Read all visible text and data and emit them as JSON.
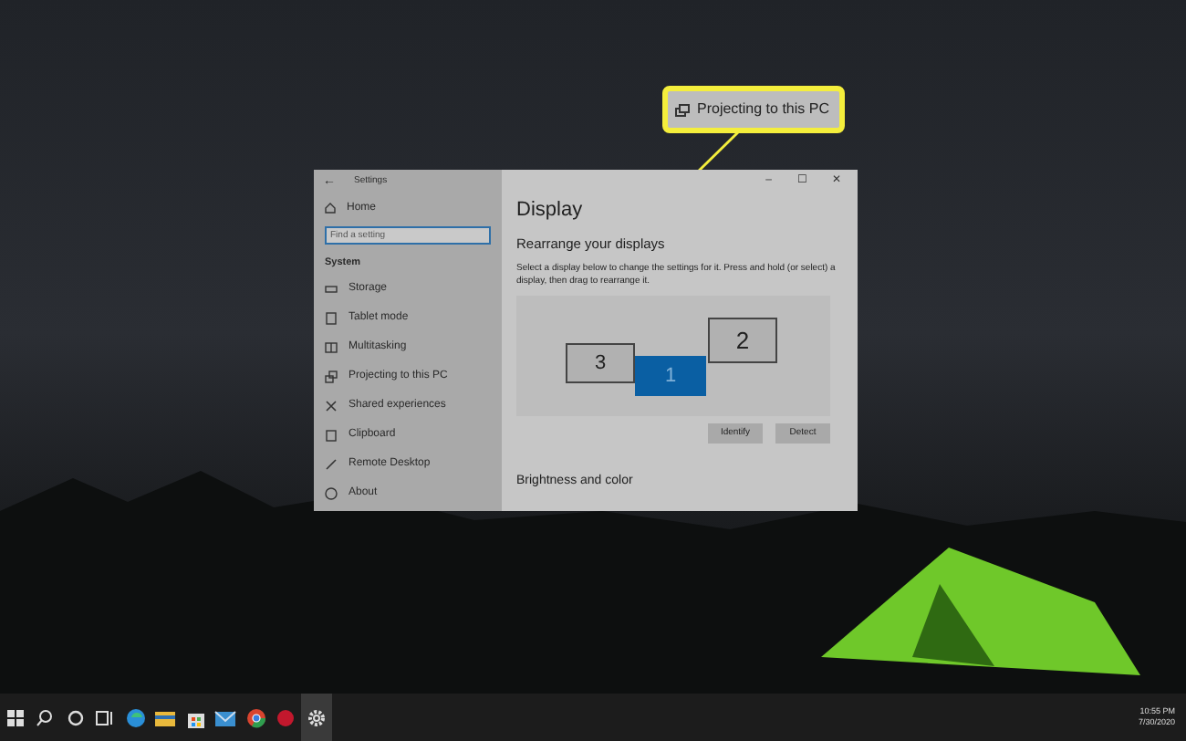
{
  "callout": {
    "label": "Projecting to this PC"
  },
  "window": {
    "title": "Settings",
    "back": "←",
    "controls": [
      "–",
      "☐",
      "✕"
    ]
  },
  "sidebar": {
    "home": "Home",
    "search": {
      "placeholder": "Find a setting"
    },
    "section": "System",
    "items": [
      {
        "label": "Storage"
      },
      {
        "label": "Tablet mode"
      },
      {
        "label": "Multitasking"
      },
      {
        "label": "Projecting to this PC"
      },
      {
        "label": "Shared experiences"
      },
      {
        "label": "Clipboard"
      },
      {
        "label": "Remote Desktop"
      },
      {
        "label": "About"
      }
    ]
  },
  "content": {
    "title": "Display",
    "heading": "Rearrange your displays",
    "description": "Select a display below to change the settings for it. Press and hold (or select) a display, then drag to rearrange it.",
    "monitors": [
      {
        "label": "3",
        "selected": false
      },
      {
        "label": "1",
        "selected": true
      },
      {
        "label": "2",
        "selected": false
      }
    ],
    "buttons": [
      "Identify",
      "Detect"
    ],
    "next_heading": "Brightness and color"
  },
  "taskbar": {
    "apps": [
      {
        "kind": "start",
        "active": false
      },
      {
        "kind": "search",
        "active": false
      },
      {
        "kind": "cortana",
        "active": false
      },
      {
        "kind": "taskview",
        "active": false
      },
      {
        "kind": "edge",
        "active": false
      },
      {
        "kind": "explorer",
        "active": false
      },
      {
        "kind": "store",
        "active": false
      },
      {
        "kind": "mail",
        "active": false
      },
      {
        "kind": "chrome",
        "active": false
      },
      {
        "kind": "redapp",
        "active": false
      },
      {
        "kind": "settings",
        "active": true
      }
    ],
    "time": "10:55 PM",
    "date": "7/30/2020"
  }
}
